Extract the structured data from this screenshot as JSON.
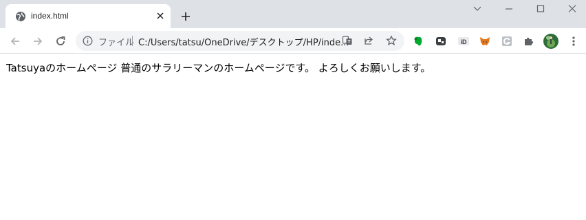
{
  "tab": {
    "title": "index.html",
    "favicon": "globe-icon"
  },
  "toolbar": {
    "back_icon": "arrow-left-icon",
    "forward_icon": "arrow-right-icon",
    "reload_icon": "reload-icon"
  },
  "omnibox": {
    "scheme_label": "ファイル",
    "url": "C:/Users/tatsu/OneDrive/デスクトップ/HP/inde..."
  },
  "extensions": [
    "evernote-icon",
    "extension-dark-icon",
    "id-icon",
    "metamask-fox-icon",
    "g-extension-icon",
    "puzzle-icon",
    "profile-avatar"
  ],
  "page": {
    "title": "Tatsuyaのホームページ",
    "body": "普通のサラリーマンのホームページです。 よろしくお願いします。"
  },
  "colors": {
    "tabstrip": "#dee1e6",
    "omnibox": "#f1f3f4",
    "evernote_green": "#00a82d",
    "metamask_orange": "#e2761b"
  }
}
